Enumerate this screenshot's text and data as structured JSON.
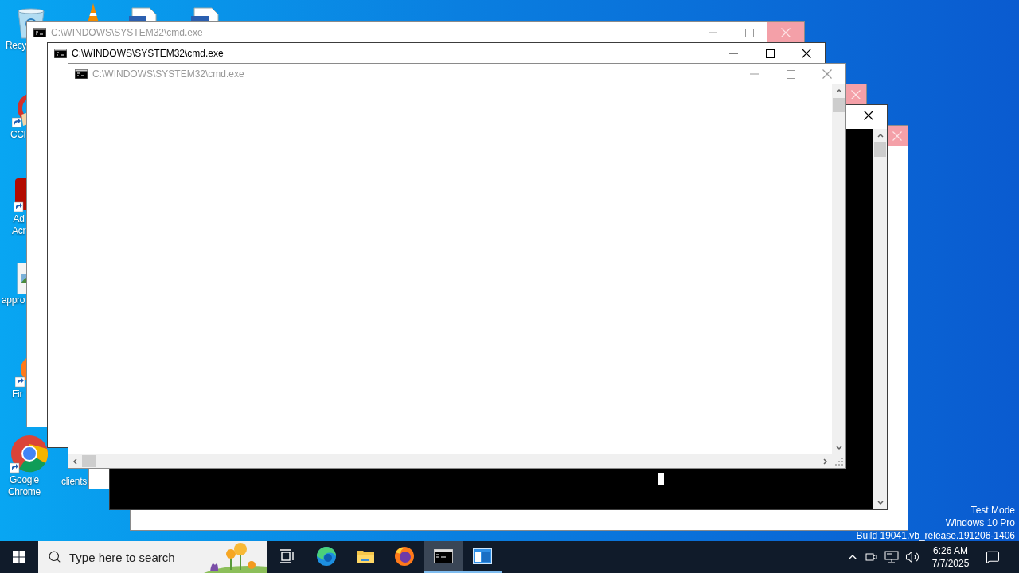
{
  "desktop_icons": [
    {
      "kind": "recycle_bin",
      "lines": [
        "Recy"
      ]
    },
    {
      "kind": "vlc"
    },
    {
      "kind": "document"
    },
    {
      "kind": "document"
    },
    {
      "kind": "ccleaner",
      "lines": [
        "CCl"
      ]
    },
    {
      "kind": "acrobat",
      "lines": [
        "Ad",
        "Acr"
      ]
    },
    {
      "kind": "image_file",
      "lines": [
        "appro"
      ]
    },
    {
      "kind": "firefox",
      "lines": [
        "Fir"
      ]
    },
    {
      "kind": "chrome",
      "lines": [
        "Google",
        "Chrome"
      ]
    },
    {
      "kind": "file",
      "lines": [
        "clients"
      ]
    }
  ],
  "windows": [
    {
      "title": "C:\\WINDOWS\\SYSTEM32\\cmd.exe",
      "active": false,
      "close_highlighted": true,
      "kind": "blank"
    },
    {
      "title": "C:\\WINDOWS\\SYSTEM32\\cmd.exe",
      "active": true,
      "close_highlighted": false,
      "kind": "blank"
    },
    {
      "title": "C:\\WINDOWS\\SYSTEM32\\cmd.exe",
      "active": false,
      "close_highlighted": false,
      "kind": "scroll"
    },
    {
      "active": false,
      "close_highlighted": true,
      "kind": "blank"
    },
    {
      "active": true,
      "close_highlighted": false,
      "kind": "console"
    },
    {
      "active": false,
      "close_highlighted": true,
      "kind": "blank"
    }
  ],
  "desktop_notice": [
    "Test Mode",
    "Windows 10 Pro",
    "Build 19041.vb_release.191206-1406"
  ],
  "taskbar": {
    "search": {
      "placeholder": "Type here to search"
    },
    "apps": [
      {
        "kind": "task_view",
        "active": false,
        "open": false
      },
      {
        "kind": "edge",
        "active": false,
        "open": false
      },
      {
        "kind": "file_explorer",
        "active": false,
        "open": false
      },
      {
        "kind": "firefox",
        "active": false,
        "open": false
      },
      {
        "kind": "cmd",
        "active": true,
        "open": true
      },
      {
        "kind": "app_window",
        "active": false,
        "open": true
      }
    ],
    "tray": {
      "time": "6:26 AM",
      "date": "7/7/2025"
    }
  }
}
